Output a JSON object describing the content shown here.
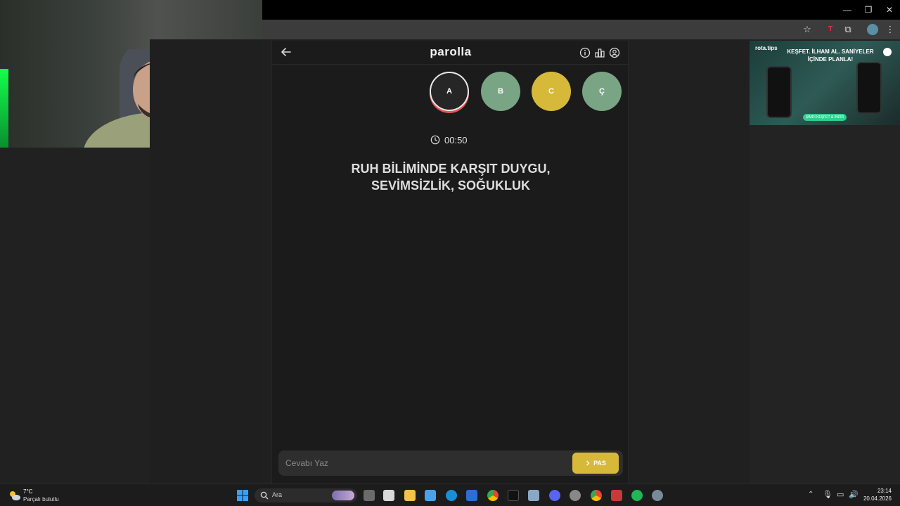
{
  "game": {
    "title": "parolla",
    "letters": [
      {
        "label": "A",
        "state": "active"
      },
      {
        "label": "B",
        "state": "green"
      },
      {
        "label": "C",
        "state": "yellow"
      },
      {
        "label": "Ç",
        "state": "green"
      }
    ],
    "timer": "00:50",
    "question_line1": "RUH BİLİMİNDE KARŞIT DUYGU,",
    "question_line2": "SEVİMSİZLİK, SOĞUKLUK",
    "answer_placeholder": "Cevabı Yaz",
    "pass_label": "PAS"
  },
  "ad": {
    "brand": "rota.tips",
    "title": "KEŞFET. İLHAM AL. SANİYELER İÇİNDE PLANLA!",
    "cta": "ŞİMDİ KEŞFET & İNDİR"
  },
  "taskbar": {
    "weather_temp": "7°C",
    "weather_desc": "Parçalı bulutlu",
    "search_label": "Ara",
    "time": "23:14",
    "date": "20.04.2026"
  },
  "colors": {
    "green": "#7aa584",
    "yellow": "#d7b93a",
    "active_ring": "#e25555"
  }
}
